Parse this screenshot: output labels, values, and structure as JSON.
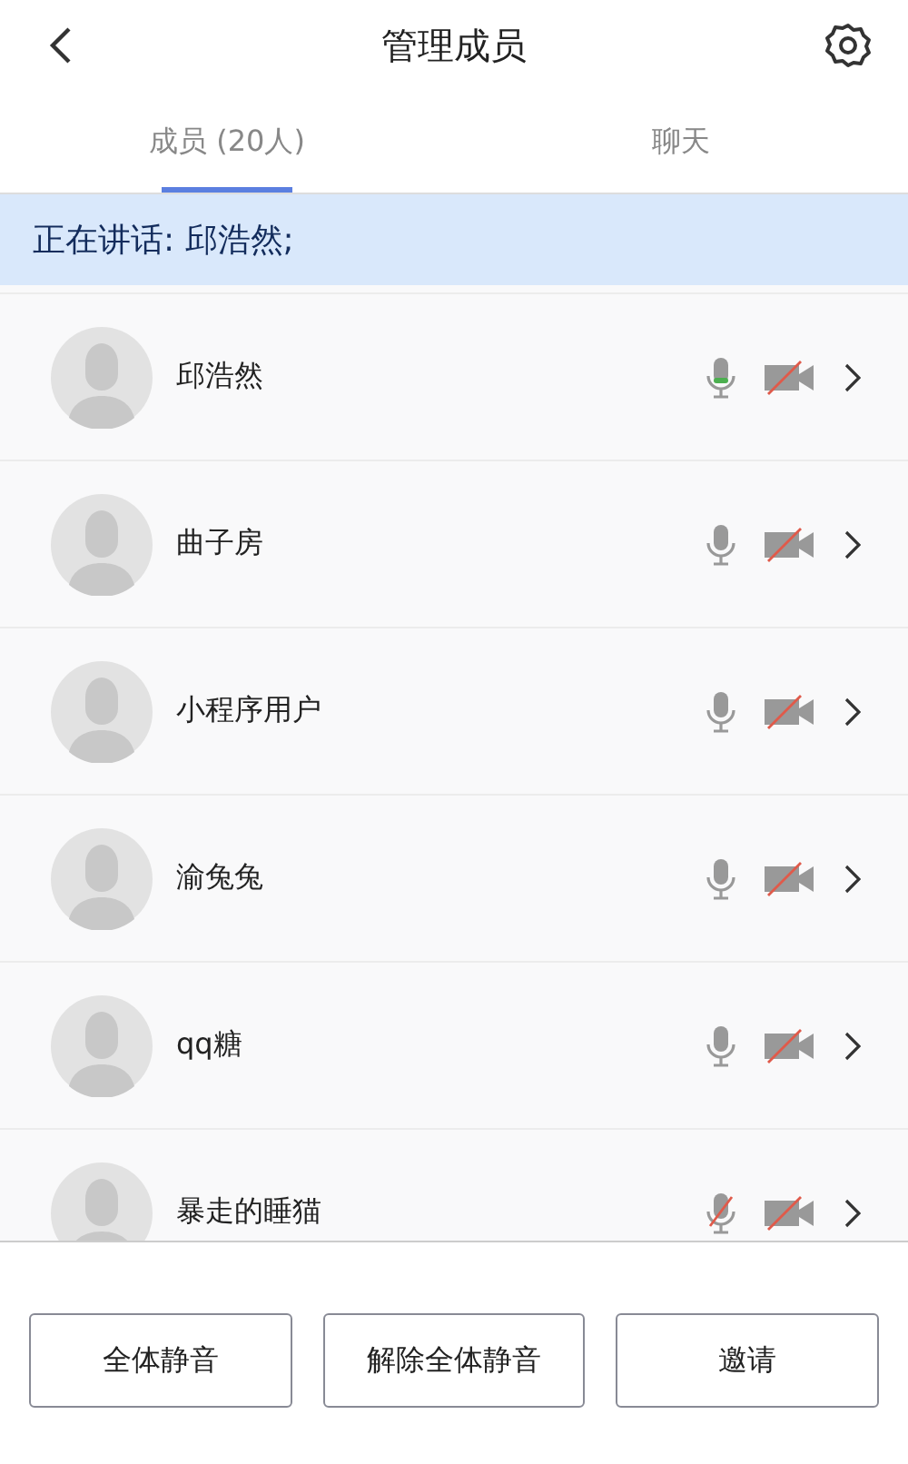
{
  "header": {
    "title": "管理成员"
  },
  "tabs": [
    {
      "label": "成员 (20人)",
      "selected": true
    },
    {
      "label": "聊天",
      "selected": false
    }
  ],
  "banner": {
    "text": "正在讲话: 邱浩然;"
  },
  "members": [
    {
      "name": "邱浩然",
      "speaking": true,
      "mic_muted": false,
      "camera_off": true
    },
    {
      "name": "曲子房",
      "speaking": false,
      "mic_muted": false,
      "camera_off": true
    },
    {
      "name": "小程序用户",
      "speaking": false,
      "mic_muted": false,
      "camera_off": true
    },
    {
      "name": "渝兔兔",
      "speaking": false,
      "mic_muted": false,
      "camera_off": true
    },
    {
      "name": "qq糖",
      "speaking": false,
      "mic_muted": false,
      "camera_off": true
    },
    {
      "name": "暴走的睡猫",
      "speaking": false,
      "mic_muted": true,
      "camera_off": true
    }
  ],
  "buttons": [
    "全体静音",
    "解除全体静音",
    "邀请"
  ]
}
